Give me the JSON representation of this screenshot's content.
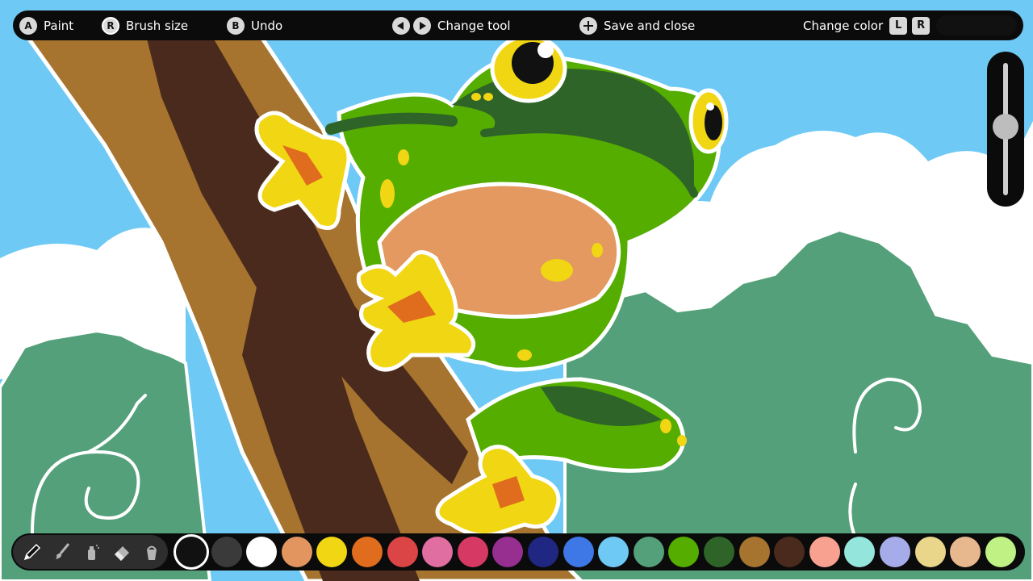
{
  "controls": {
    "paint": {
      "button": "A",
      "label": "Paint"
    },
    "brush_size": {
      "button": "R",
      "label": "Brush size"
    },
    "undo": {
      "button": "B",
      "label": "Undo"
    },
    "change_tool": {
      "label": "Change tool"
    },
    "save_close": {
      "label": "Save and close"
    },
    "change_color": {
      "label": "Change color",
      "left": "L",
      "right": "R"
    },
    "current_color": "#111111"
  },
  "brush_size_level": 0.52,
  "tools": [
    {
      "name": "pencil-icon",
      "selected": true
    },
    {
      "name": "brush-icon",
      "selected": false
    },
    {
      "name": "spray-icon",
      "selected": false
    },
    {
      "name": "eraser-icon",
      "selected": false
    },
    {
      "name": "bucket-icon",
      "selected": false
    }
  ],
  "palette": {
    "selected_index": 0,
    "colors": [
      "#111111",
      "#3a3a3a",
      "#ffffff",
      "#e39560",
      "#f1d613",
      "#e06c1e",
      "#dc4545",
      "#e16ea0",
      "#d63963",
      "#962f90",
      "#1f2782",
      "#3e78e6",
      "#6ec9f5",
      "#54a07a",
      "#55ad00",
      "#2f6428",
      "#a6742f",
      "#4a2a1c",
      "#f9a190",
      "#94e6dc",
      "#a6acea",
      "#ead68a",
      "#e7b88d",
      "#bff185"
    ]
  },
  "scene_colors": {
    "sky": "#6ec9f5",
    "cloud": "#ffffff",
    "bush": "#54a07a",
    "trunk_light": "#a6742f",
    "trunk_dark": "#4a2a1c",
    "frog_green": "#55ad00",
    "frog_dark": "#2f6428",
    "belly": "#e39960",
    "toe": "#f1d613",
    "toe_inner": "#e06c1e"
  }
}
